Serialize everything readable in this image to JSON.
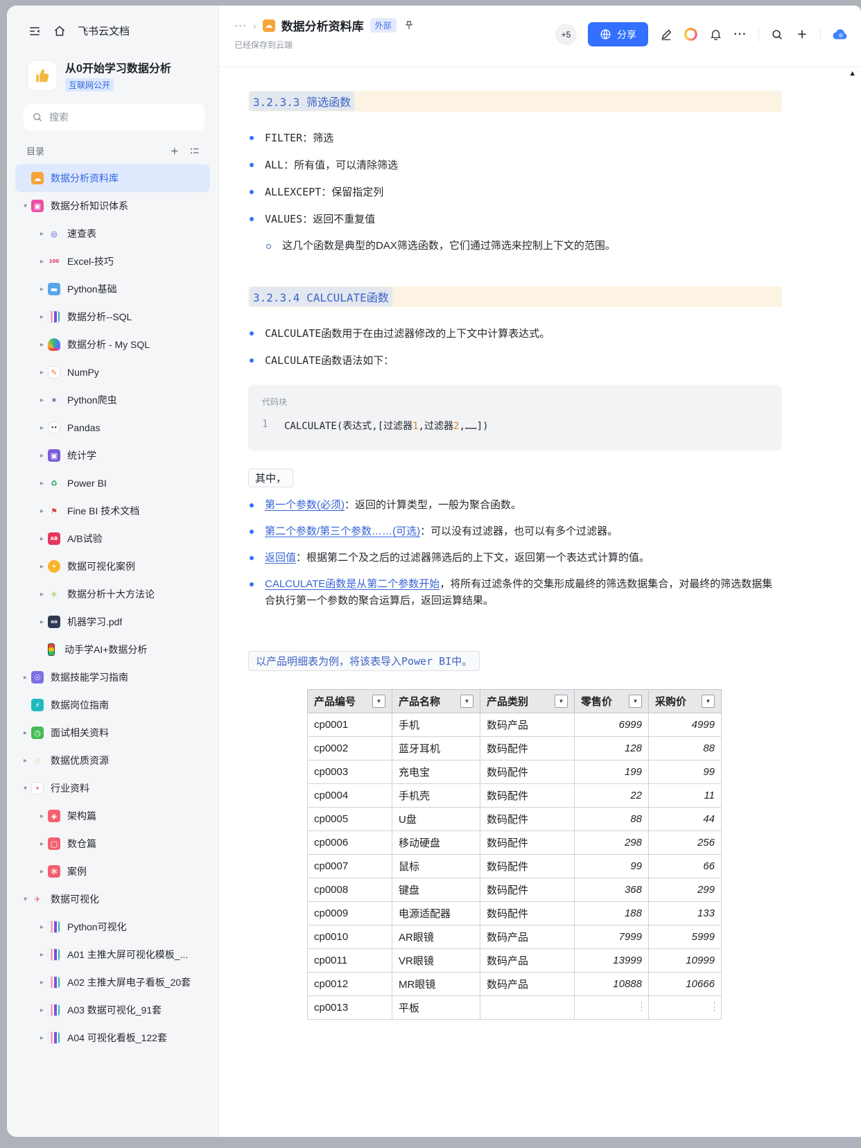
{
  "icons": {
    "plus": "+",
    "scroll_up": "▲",
    "doc_glyph": "☁"
  },
  "sidebar": {
    "workspace_title": "飞书云文档",
    "doc_title": "从0开始学习数据分析",
    "doc_badge": "互联网公开",
    "search_placeholder": "搜索",
    "catalog_label": "目录",
    "items": [
      {
        "label": "数据分析资料库",
        "level": 0,
        "arrow": null,
        "selected": true,
        "icon": {
          "name": "cloud-doc-icon",
          "glyph": "☁",
          "fg": "#fff",
          "bg": "#f7a43c"
        }
      },
      {
        "label": "数据分析知识体系",
        "level": 0,
        "arrow": "d",
        "icon": {
          "name": "knowledge-icon",
          "glyph": "▣",
          "fg": "#fff",
          "bg": "#ec4fa4"
        }
      },
      {
        "label": "速查表",
        "level": 1,
        "arrow": "r",
        "icon": {
          "name": "magnifier-icon",
          "glyph": "◎",
          "fg": "#2f54c9"
        }
      },
      {
        "label": "Excel-技巧",
        "level": 1,
        "arrow": "r",
        "icon": {
          "name": "hundred-points-icon",
          "glyph": "100",
          "fg": "#e0315b",
          "cls": "small"
        }
      },
      {
        "label": "Python基础",
        "level": 1,
        "arrow": "r",
        "icon": {
          "name": "laptop-icon",
          "glyph": "▬",
          "fg": "#fff",
          "bg": "#58a6e8"
        }
      },
      {
        "label": "数据分析--SQL",
        "level": 1,
        "arrow": "r",
        "icon": {
          "name": "bar-chart-icon",
          "cls": "bars"
        }
      },
      {
        "label": "数据分析 - My SQL",
        "level": 1,
        "arrow": "r",
        "icon": {
          "name": "rainbow-icon",
          "cls": "rainbow"
        }
      },
      {
        "label": "NumPy",
        "level": 1,
        "arrow": "r",
        "icon": {
          "name": "memo-icon",
          "glyph": "✎",
          "fg": "#e8762c",
          "bg": "#fff",
          "bd": "#e1e3e6"
        }
      },
      {
        "label": "Python爬虫",
        "level": 1,
        "arrow": "r",
        "icon": {
          "name": "ant-icon",
          "glyph": "✶",
          "fg": "#4a3f9f"
        }
      },
      {
        "label": "Pandas",
        "level": 1,
        "arrow": "r",
        "icon": {
          "name": "panda-icon",
          "glyph": "••",
          "fg": "#1f2329",
          "bg": "#fff",
          "bd": "#e1e3e6",
          "cls": "small round"
        }
      },
      {
        "label": "统计学",
        "level": 1,
        "arrow": "r",
        "icon": {
          "name": "floppy-disk-icon",
          "glyph": "▣",
          "fg": "#fff",
          "bg": "#7b5bd6"
        }
      },
      {
        "label": "Power BI",
        "level": 1,
        "arrow": "r",
        "icon": {
          "name": "recycle-icon",
          "glyph": "♻",
          "fg": "#23a757"
        }
      },
      {
        "label": "Fine BI 技术文档",
        "level": 1,
        "arrow": "r",
        "icon": {
          "name": "pushpin-icon",
          "glyph": "⚑",
          "fg": "#e23c39"
        }
      },
      {
        "label": "A/B试验",
        "level": 1,
        "arrow": "r",
        "icon": {
          "name": "ab-test-icon",
          "glyph": "AB",
          "fg": "#fff",
          "bg": "#e5395c",
          "cls": "small"
        }
      },
      {
        "label": "数据可视化案例",
        "level": 1,
        "arrow": "r",
        "icon": {
          "name": "medal-icon",
          "glyph": "★",
          "fg": "#fff",
          "bg": "#f8b62c",
          "cls": "small round"
        }
      },
      {
        "label": "数据分析十大方法论",
        "level": 1,
        "arrow": "r",
        "icon": {
          "name": "asterisk-icon",
          "glyph": "✳",
          "fg": "#8bc63f"
        }
      },
      {
        "label": "机器学习.pdf",
        "level": 1,
        "arrow": "r",
        "icon": {
          "name": "robot-icon",
          "glyph": "oo",
          "fg": "#fff",
          "bg": "#2f3b52",
          "cls": "small"
        }
      },
      {
        "label": "动手学AI+数据分析",
        "level": 1,
        "arrow": null,
        "icon": {
          "name": "traffic-light-icon",
          "cls": "traffic"
        }
      },
      {
        "label": "数据技能学习指南",
        "level": 0,
        "arrow": "r",
        "icon": {
          "name": "bulb-icon",
          "glyph": "☉",
          "fg": "#fff",
          "bg": "#7e6ee6"
        }
      },
      {
        "label": "数据岗位指南",
        "level": 0,
        "arrow": null,
        "icon": {
          "name": "lightning-icon",
          "glyph": "⚡",
          "fg": "#fff",
          "bg": "#1fb9bf"
        }
      },
      {
        "label": "面试相关资料",
        "level": 0,
        "arrow": "r",
        "icon": {
          "name": "clock-icon",
          "glyph": "◷",
          "fg": "#fff",
          "bg": "#46bc55"
        }
      },
      {
        "label": "数据优质资源",
        "level": 0,
        "arrow": "r",
        "icon": {
          "name": "thumbs-up-icon",
          "glyph": "☝",
          "fg": "#f2a93b"
        }
      },
      {
        "label": "行业资料",
        "level": 0,
        "arrow": "d",
        "icon": {
          "name": "shirt-icon",
          "glyph": "∨",
          "fg": "#e25672",
          "bg": "#fff",
          "bd": "#e1e3e6",
          "cls": "small"
        }
      },
      {
        "label": "架构篇",
        "level": 1,
        "arrow": "r",
        "icon": {
          "name": "architecture-icon",
          "glyph": "◈",
          "fg": "#fff",
          "bg": "#f2606f"
        }
      },
      {
        "label": "数仓篇",
        "level": 1,
        "arrow": "r",
        "icon": {
          "name": "warehouse-icon",
          "glyph": "▢",
          "fg": "#fff",
          "bg": "#f2606f"
        }
      },
      {
        "label": "案例",
        "level": 1,
        "arrow": "r",
        "icon": {
          "name": "case-icon",
          "glyph": "✻",
          "fg": "#fff",
          "bg": "#f2606f"
        }
      },
      {
        "label": "数据可视化",
        "level": 0,
        "arrow": "d",
        "icon": {
          "name": "rocket-icon",
          "glyph": "✈",
          "fg": "#e85c8a"
        }
      },
      {
        "label": "Python可视化",
        "level": 1,
        "arrow": "r",
        "icon": {
          "name": "bar-chart-icon",
          "cls": "bars"
        }
      },
      {
        "label": "A01 主推大屏可视化模板_...",
        "level": 1,
        "arrow": "r",
        "icon": {
          "name": "bar-chart-icon",
          "cls": "bars"
        }
      },
      {
        "label": "A02 主推大屏电子看板_20套",
        "level": 1,
        "arrow": "r",
        "icon": {
          "name": "bar-chart-icon",
          "cls": "bars"
        }
      },
      {
        "label": "A03 数据可视化_91套",
        "level": 1,
        "arrow": "r",
        "icon": {
          "name": "bar-chart-icon",
          "cls": "bars"
        }
      },
      {
        "label": "A04 可视化看板_122套",
        "level": 1,
        "arrow": "r",
        "icon": {
          "name": "bar-chart-icon",
          "cls": "bars"
        }
      }
    ]
  },
  "header": {
    "breadcrumb_more": "···",
    "chevron": "›",
    "doc_name": "数据分析资料库",
    "external_badge": "外部",
    "save_status": "已经保存到云端",
    "collaborators_badge": "+5",
    "share_label": "分享",
    "more_label": "···"
  },
  "content": {
    "h1": "3.2.3.3 筛选函数",
    "filter_bullets": [
      {
        "lead": "FILTER",
        "rest": "：筛选"
      },
      {
        "lead": "ALL",
        "rest": "：所有值，可以清除筛选"
      },
      {
        "lead": "ALLEXCEPT",
        "rest": "：保留指定列"
      },
      {
        "lead": "VALUES",
        "rest": "：返回不重复值"
      }
    ],
    "filter_note_items": [
      {
        "text": "这几个函数是典型的DAX筛选函数，它们通过筛选来控制上下文的范围。"
      }
    ],
    "h2": "3.2.3.4 CALCULATE函数",
    "calc_bullets": [
      {
        "lead": "CALCULATE",
        "rest": "函数用于在由过滤器修改的上下文中计算表达式。"
      },
      {
        "lead": "CALCULATE",
        "rest": "函数语法如下："
      }
    ],
    "code": {
      "label": "代码块",
      "line_no": "1",
      "segments": [
        {
          "t": "CALCULATE(表达式,[过滤器",
          "c": "code"
        },
        {
          "t": "1",
          "c": "num"
        },
        {
          "t": ",过滤器",
          "c": "code"
        },
        {
          "t": "2",
          "c": "num"
        },
        {
          "t": ",……])",
          "c": "code"
        }
      ]
    },
    "among_label": "其中，",
    "param_bullets": [
      {
        "lead": "第一个参数(必须)",
        "link": true,
        "rest": "：返回的计算类型，一般为聚合函数。"
      },
      {
        "lead": "第二个参数/第三个参数……(可选)",
        "link": true,
        "rest": "：可以没有过滤器，也可以有多个过滤器。"
      },
      {
        "lead": "返回值",
        "link": true,
        "rest": "：根据第二个及之后的过滤器筛选后的上下文，返回第一个表达式计算的值。"
      },
      {
        "lead": "CALCULATE函数是从第二个参数开始",
        "link": true,
        "rest": "，将所有过滤条件的交集形成最终的筛选数据集合，对最终的筛选数据集合执行第一个参数的聚合运算后，返回运算结果。"
      }
    ],
    "example_note": "以产品明细表为例，将该表导入Power BI中。",
    "table": {
      "headers": [
        "产品编号",
        "产品名称",
        "产品类别",
        "零售价",
        "采购价"
      ],
      "rows": [
        [
          "cp0001",
          "手机",
          "数码产品",
          "6999",
          "4999"
        ],
        [
          "cp0002",
          "蓝牙耳机",
          "数码配件",
          "128",
          "88"
        ],
        [
          "cp0003",
          "充电宝",
          "数码配件",
          "199",
          "99"
        ],
        [
          "cp0004",
          "手机壳",
          "数码配件",
          "22",
          "11"
        ],
        [
          "cp0005",
          "U盘",
          "数码配件",
          "88",
          "44"
        ],
        [
          "cp0006",
          "移动硬盘",
          "数码配件",
          "298",
          "256"
        ],
        [
          "cp0007",
          "鼠标",
          "数码配件",
          "99",
          "66"
        ],
        [
          "cp0008",
          "键盘",
          "数码配件",
          "368",
          "299"
        ],
        [
          "cp0009",
          "电源适配器",
          "数码配件",
          "188",
          "133"
        ],
        [
          "cp0010",
          "AR眼镜",
          "数码产品",
          "7999",
          "5999"
        ],
        [
          "cp0011",
          "VR眼镜",
          "数码产品",
          "13999",
          "10999"
        ],
        [
          "cp0012",
          "MR眼镜",
          "数码产品",
          "10888",
          "10666"
        ],
        [
          "cp0013",
          "平板",
          "",
          "",
          ""
        ]
      ]
    }
  }
}
